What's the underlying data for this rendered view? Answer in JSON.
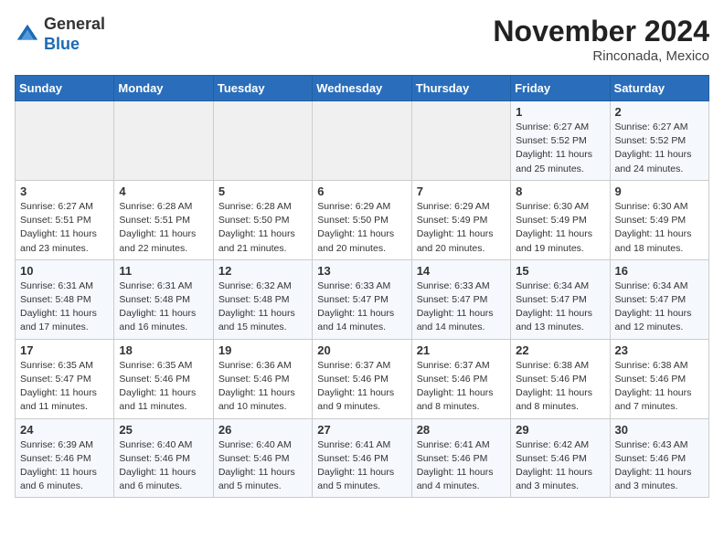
{
  "header": {
    "logo_line1": "General",
    "logo_line2": "Blue",
    "month_title": "November 2024",
    "subtitle": "Rinconada, Mexico"
  },
  "days_of_week": [
    "Sunday",
    "Monday",
    "Tuesday",
    "Wednesday",
    "Thursday",
    "Friday",
    "Saturday"
  ],
  "weeks": [
    [
      {
        "day": "",
        "info": ""
      },
      {
        "day": "",
        "info": ""
      },
      {
        "day": "",
        "info": ""
      },
      {
        "day": "",
        "info": ""
      },
      {
        "day": "",
        "info": ""
      },
      {
        "day": "1",
        "info": "Sunrise: 6:27 AM\nSunset: 5:52 PM\nDaylight: 11 hours and 25 minutes."
      },
      {
        "day": "2",
        "info": "Sunrise: 6:27 AM\nSunset: 5:52 PM\nDaylight: 11 hours and 24 minutes."
      }
    ],
    [
      {
        "day": "3",
        "info": "Sunrise: 6:27 AM\nSunset: 5:51 PM\nDaylight: 11 hours and 23 minutes."
      },
      {
        "day": "4",
        "info": "Sunrise: 6:28 AM\nSunset: 5:51 PM\nDaylight: 11 hours and 22 minutes."
      },
      {
        "day": "5",
        "info": "Sunrise: 6:28 AM\nSunset: 5:50 PM\nDaylight: 11 hours and 21 minutes."
      },
      {
        "day": "6",
        "info": "Sunrise: 6:29 AM\nSunset: 5:50 PM\nDaylight: 11 hours and 20 minutes."
      },
      {
        "day": "7",
        "info": "Sunrise: 6:29 AM\nSunset: 5:49 PM\nDaylight: 11 hours and 20 minutes."
      },
      {
        "day": "8",
        "info": "Sunrise: 6:30 AM\nSunset: 5:49 PM\nDaylight: 11 hours and 19 minutes."
      },
      {
        "day": "9",
        "info": "Sunrise: 6:30 AM\nSunset: 5:49 PM\nDaylight: 11 hours and 18 minutes."
      }
    ],
    [
      {
        "day": "10",
        "info": "Sunrise: 6:31 AM\nSunset: 5:48 PM\nDaylight: 11 hours and 17 minutes."
      },
      {
        "day": "11",
        "info": "Sunrise: 6:31 AM\nSunset: 5:48 PM\nDaylight: 11 hours and 16 minutes."
      },
      {
        "day": "12",
        "info": "Sunrise: 6:32 AM\nSunset: 5:48 PM\nDaylight: 11 hours and 15 minutes."
      },
      {
        "day": "13",
        "info": "Sunrise: 6:33 AM\nSunset: 5:47 PM\nDaylight: 11 hours and 14 minutes."
      },
      {
        "day": "14",
        "info": "Sunrise: 6:33 AM\nSunset: 5:47 PM\nDaylight: 11 hours and 14 minutes."
      },
      {
        "day": "15",
        "info": "Sunrise: 6:34 AM\nSunset: 5:47 PM\nDaylight: 11 hours and 13 minutes."
      },
      {
        "day": "16",
        "info": "Sunrise: 6:34 AM\nSunset: 5:47 PM\nDaylight: 11 hours and 12 minutes."
      }
    ],
    [
      {
        "day": "17",
        "info": "Sunrise: 6:35 AM\nSunset: 5:47 PM\nDaylight: 11 hours and 11 minutes."
      },
      {
        "day": "18",
        "info": "Sunrise: 6:35 AM\nSunset: 5:46 PM\nDaylight: 11 hours and 11 minutes."
      },
      {
        "day": "19",
        "info": "Sunrise: 6:36 AM\nSunset: 5:46 PM\nDaylight: 11 hours and 10 minutes."
      },
      {
        "day": "20",
        "info": "Sunrise: 6:37 AM\nSunset: 5:46 PM\nDaylight: 11 hours and 9 minutes."
      },
      {
        "day": "21",
        "info": "Sunrise: 6:37 AM\nSunset: 5:46 PM\nDaylight: 11 hours and 8 minutes."
      },
      {
        "day": "22",
        "info": "Sunrise: 6:38 AM\nSunset: 5:46 PM\nDaylight: 11 hours and 8 minutes."
      },
      {
        "day": "23",
        "info": "Sunrise: 6:38 AM\nSunset: 5:46 PM\nDaylight: 11 hours and 7 minutes."
      }
    ],
    [
      {
        "day": "24",
        "info": "Sunrise: 6:39 AM\nSunset: 5:46 PM\nDaylight: 11 hours and 6 minutes."
      },
      {
        "day": "25",
        "info": "Sunrise: 6:40 AM\nSunset: 5:46 PM\nDaylight: 11 hours and 6 minutes."
      },
      {
        "day": "26",
        "info": "Sunrise: 6:40 AM\nSunset: 5:46 PM\nDaylight: 11 hours and 5 minutes."
      },
      {
        "day": "27",
        "info": "Sunrise: 6:41 AM\nSunset: 5:46 PM\nDaylight: 11 hours and 5 minutes."
      },
      {
        "day": "28",
        "info": "Sunrise: 6:41 AM\nSunset: 5:46 PM\nDaylight: 11 hours and 4 minutes."
      },
      {
        "day": "29",
        "info": "Sunrise: 6:42 AM\nSunset: 5:46 PM\nDaylight: 11 hours and 3 minutes."
      },
      {
        "day": "30",
        "info": "Sunrise: 6:43 AM\nSunset: 5:46 PM\nDaylight: 11 hours and 3 minutes."
      }
    ]
  ]
}
